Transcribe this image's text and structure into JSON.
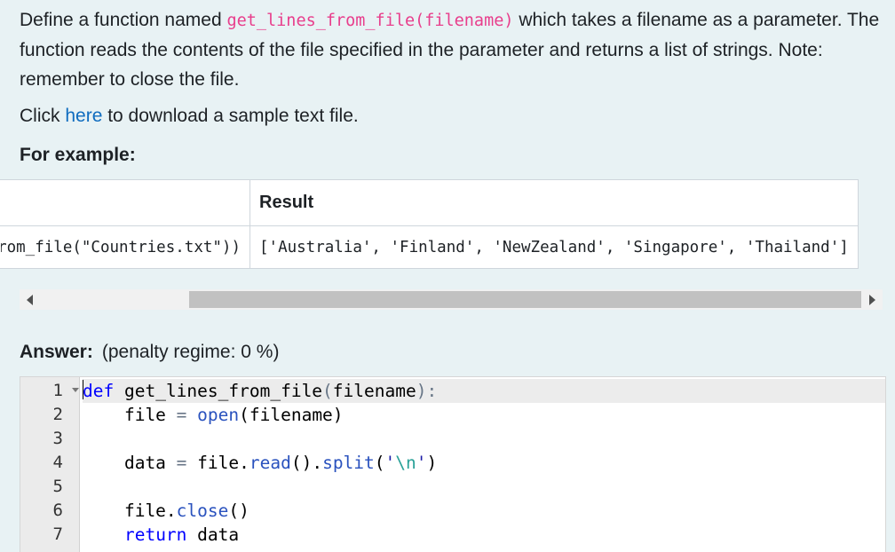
{
  "question": {
    "p1_before": "Define a function named ",
    "p1_code": "get_lines_from_file(filename)",
    "p1_after": " which takes a filename as a parameter. The function reads the contents of the file specified in the parameter and returns a list of strings. Note: remember to close the file.",
    "p2_before": "Click ",
    "p2_link": "here",
    "p2_after": " to download a sample text file.",
    "for_example": "For example:"
  },
  "example_table": {
    "headers": [
      "",
      "Result"
    ],
    "rows": [
      [
        "print(get_lines_from_file(\"Countries.txt\"))",
        "['Australia', 'Finland', 'NewZealand', 'Singapore', 'Thailand']"
      ]
    ]
  },
  "answer": {
    "label": "Answer:",
    "penalty": "(penalty regime: 0 %)"
  },
  "editor": {
    "line_numbers": [
      "1",
      "2",
      "3",
      "4",
      "5",
      "6",
      "7"
    ],
    "lines": [
      "def get_lines_from_file(filename):",
      "    file = open(filename)",
      "",
      "    data = file.read().split('\\n')",
      "",
      "    file.close()",
      "    return data"
    ]
  }
}
